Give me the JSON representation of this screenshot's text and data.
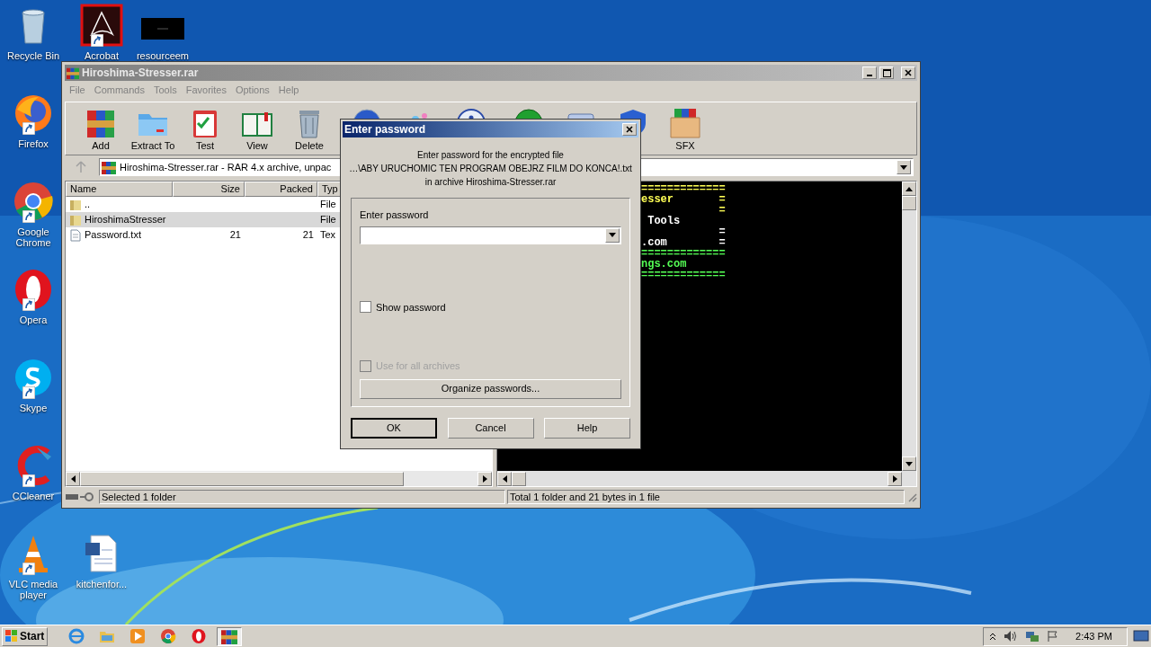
{
  "desktop_icons": [
    {
      "label": "Recycle Bin",
      "kind": "recycle"
    },
    {
      "label": "Acrobat",
      "kind": "acrobat"
    },
    {
      "label": "resourceem",
      "kind": "blackfile"
    },
    {
      "label": "Firefox",
      "kind": "firefox"
    },
    {
      "label": "Google Chrome",
      "kind": "chrome"
    },
    {
      "label": "Opera",
      "kind": "opera"
    },
    {
      "label": "Skype",
      "kind": "skype"
    },
    {
      "label": "CCleaner",
      "kind": "ccleaner"
    },
    {
      "label": "VLC media player",
      "kind": "vlc"
    },
    {
      "label": "kitchenfor...",
      "kind": "word"
    }
  ],
  "window": {
    "title": "Hiroshima-Stresser.rar",
    "menu": [
      "File",
      "Commands",
      "Tools",
      "Favorites",
      "Options",
      "Help"
    ],
    "toolbar": [
      {
        "label": "Add",
        "kind": "add"
      },
      {
        "label": "Extract To",
        "kind": "extract"
      },
      {
        "label": "Test",
        "kind": "test"
      },
      {
        "label": "View",
        "kind": "view"
      },
      {
        "label": "Delete",
        "kind": "delete"
      },
      {
        "kind": "find"
      },
      {
        "kind": "wizard"
      },
      {
        "kind": "info"
      },
      {
        "kind": "scan"
      },
      {
        "kind": "comment"
      },
      {
        "kind": "protect"
      },
      {
        "label": "SFX",
        "kind": "sfx"
      }
    ],
    "address": "Hiroshima-Stresser.rar - RAR 4.x archive, unpac",
    "columns": [
      "Name",
      "Size",
      "Packed",
      "Typ"
    ],
    "rows": [
      {
        "name": "..",
        "type": "File",
        "kind": "folder",
        "selected": false
      },
      {
        "name": "HiroshimaStresser",
        "type": "File",
        "kind": "folder",
        "selected": true
      },
      {
        "name": "Password.txt",
        "size": "21",
        "packed": "21",
        "type": "Tex",
        "kind": "file",
        "selected": false
      }
    ],
    "console_lines": [
      {
        "text": "=============",
        "color": "#ffff55"
      },
      {
        "text": "esser       =",
        "color": "#ffff55"
      },
      {
        "text": "            =",
        "color": "#ffff55"
      },
      {
        "text": " Tools",
        "color": "#ffffff"
      },
      {
        "text": "            =",
        "color": "#ffffff"
      },
      {
        "text": ".com        =",
        "color": "#ffffff"
      },
      {
        "text": "=============",
        "color": "#55ff55"
      },
      {
        "text": "ngs.com",
        "color": "#55ff55"
      },
      {
        "text": "=============",
        "color": "#55ff55"
      }
    ],
    "status_left": "Selected 1 folder",
    "status_right": "Total 1 folder and 21 bytes in 1 file"
  },
  "dialog": {
    "title": "Enter password",
    "message": [
      "Enter password for the encrypted file",
      "…\\ABY URUCHOMIC TEN PROGRAM OBEJRZ FILM DO KONCA!.txt",
      "in archive Hiroshima-Stresser.rar"
    ],
    "field_label": "Enter password",
    "show_password": {
      "label": "Show password",
      "checked": false,
      "disabled": false
    },
    "use_for_all": {
      "label": "Use for all archives",
      "checked": false,
      "disabled": true
    },
    "organize": "Organize passwords...",
    "buttons": [
      {
        "label": "OK",
        "selected": true
      },
      {
        "label": "Cancel",
        "selected": false
      },
      {
        "label": "Help",
        "selected": false
      }
    ]
  },
  "taskbar": {
    "start": "Start",
    "apps": [
      {
        "kind": "ie",
        "selected": false
      },
      {
        "kind": "explorer",
        "selected": false
      },
      {
        "kind": "media",
        "selected": false
      },
      {
        "kind": "chrome",
        "selected": false
      },
      {
        "kind": "opera",
        "selected": false
      },
      {
        "kind": "winrar",
        "selected": true
      }
    ],
    "clock": "2:43 PM"
  }
}
